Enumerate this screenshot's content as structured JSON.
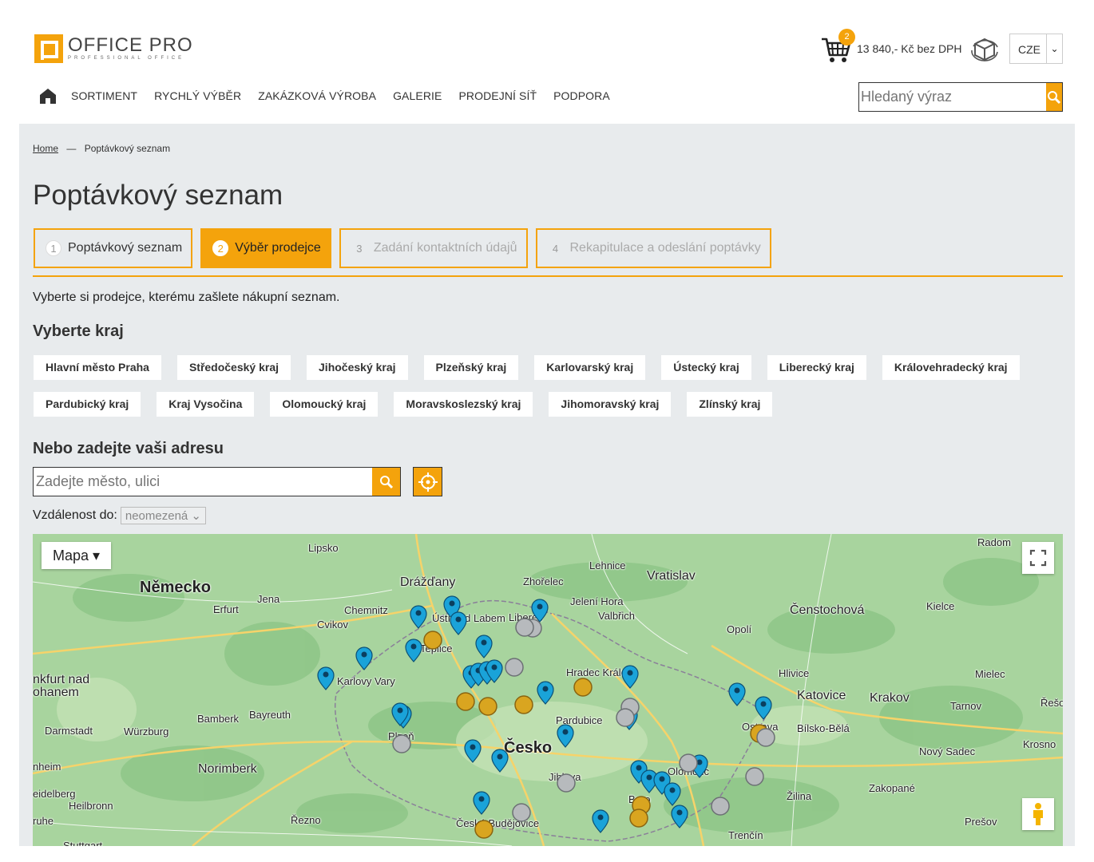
{
  "header": {
    "logo_main": "OFFICE PRO",
    "logo_sub": "PROFESSIONAL OFFICE",
    "cart_count": "2",
    "cart_total": "13 840,- Kč bez DPH",
    "lang": "CZE",
    "search_placeholder": "Hledaný výraz"
  },
  "nav": {
    "items": [
      "SORTIMENT",
      "RYCHLÝ VÝBĚR",
      "ZAKÁZKOVÁ VÝROBA",
      "GALERIE",
      "PRODEJNÍ SÍŤ",
      "PODPORA"
    ]
  },
  "breadcrumb": {
    "home": "Home",
    "sep": "—",
    "current": "Poptávkový seznam"
  },
  "page_title": "Poptávkový seznam",
  "steps": [
    {
      "num": "1",
      "label": "Poptávkový seznam"
    },
    {
      "num": "2",
      "label": "Výběr prodejce"
    },
    {
      "num": "3",
      "label": "Zadání kontaktních údajů"
    },
    {
      "num": "4",
      "label": "Rekapitulace a odeslání poptávky"
    }
  ],
  "intro": "Vyberte si prodejce, kterému zašlete nákupní seznam.",
  "region_heading": "Vyberte kraj",
  "regions_row1": [
    "Hlavní město Praha",
    "Středočeský kraj",
    "Jihočeský kraj",
    "Plzeňský kraj",
    "Karlovarský kraj",
    "Ústecký kraj",
    "Liberecký kraj",
    "Královehradecký kraj"
  ],
  "regions_row2": [
    "Pardubický kraj",
    "Kraj Vysočina",
    "Olomoucký kraj",
    "Moravskoslezský kraj",
    "Jihomoravský kraj",
    "Zlínský kraj"
  ],
  "address_heading": "Nebo zadejte vaši adresu",
  "address_placeholder": "Zadejte město, ulici",
  "distance_label": "Vzdálenost do:",
  "distance_value": "neomezená",
  "map": {
    "type_label": "Mapa",
    "cities": [
      {
        "n": "Lipsko"
      },
      {
        "n": "Německo"
      },
      {
        "n": "Drážďany"
      },
      {
        "n": "Lehnice"
      },
      {
        "n": "Vratislav"
      },
      {
        "n": "Radom"
      },
      {
        "n": "Erfurt"
      },
      {
        "n": "Jena"
      },
      {
        "n": "Chemnitz"
      },
      {
        "n": "Zhořelec"
      },
      {
        "n": "Jelení Hora"
      },
      {
        "n": "Valbřich"
      },
      {
        "n": "Čenstochová"
      },
      {
        "n": "Kielce"
      },
      {
        "n": "Cvikov"
      },
      {
        "n": "Ústí nad Labem"
      },
      {
        "n": "Teplice"
      },
      {
        "n": "Liberec"
      },
      {
        "n": "Opolí"
      },
      {
        "n": "Karlovy Vary"
      },
      {
        "n": "Hradec Králové"
      },
      {
        "n": "Hlivice"
      },
      {
        "n": "Mielec"
      },
      {
        "n": "nkfurt nad ohanem"
      },
      {
        "n": "Katovice"
      },
      {
        "n": "Krakov"
      },
      {
        "n": "Tarnov"
      },
      {
        "n": "Řešov"
      },
      {
        "n": "Bamberk"
      },
      {
        "n": "Bayreuth"
      },
      {
        "n": "Pardubice"
      },
      {
        "n": "Ostrava"
      },
      {
        "n": "Bílsko-Bělá"
      },
      {
        "n": "Darmstadt"
      },
      {
        "n": "Würzburg"
      },
      {
        "n": "Plzeň"
      },
      {
        "n": "Česko"
      },
      {
        "n": "Nový Sadec"
      },
      {
        "n": "Krosno"
      },
      {
        "n": "nheim"
      },
      {
        "n": "Norimberk"
      },
      {
        "n": "Olomouc"
      },
      {
        "n": "Jihlava"
      },
      {
        "n": "Zakopané"
      },
      {
        "n": "eidelberg"
      },
      {
        "n": "Heilbronn"
      },
      {
        "n": "Žilina"
      },
      {
        "n": "ruhe"
      },
      {
        "n": "Řezno"
      },
      {
        "n": "České Budějovice"
      },
      {
        "n": "Brno"
      },
      {
        "n": "Prešov"
      },
      {
        "n": "Stuttgart"
      },
      {
        "n": "Trenčín"
      }
    ]
  }
}
